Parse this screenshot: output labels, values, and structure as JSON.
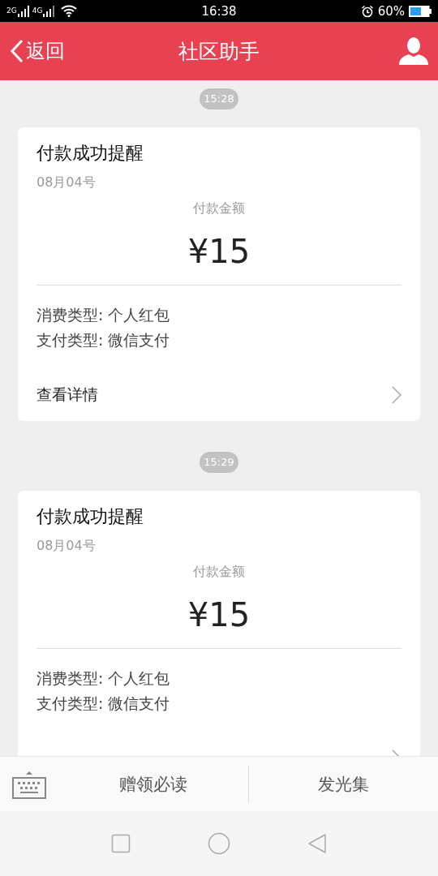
{
  "status_bar": {
    "network_labels": [
      "2G",
      "4G"
    ],
    "time": "16:38",
    "battery_percent": "60%"
  },
  "header": {
    "back_label": "返回",
    "title": "社区助手"
  },
  "messages": [
    {
      "time": "15:28",
      "card": {
        "title": "付款成功提醒",
        "date": "08月04号",
        "amount_label": "付款金额",
        "amount": "¥15",
        "details": [
          "消费类型: 个人红包",
          "支付类型: 微信支付"
        ],
        "link": "查看详情"
      }
    },
    {
      "time": "15:29",
      "card": {
        "title": "付款成功提醒",
        "date": "08月04号",
        "amount_label": "付款金额",
        "amount": "¥15",
        "details": [
          "消费类型: 个人红包",
          "支付类型: 微信支付"
        ]
      }
    }
  ],
  "bottom_menu": {
    "items": [
      "赠领必读",
      "发光集"
    ]
  }
}
